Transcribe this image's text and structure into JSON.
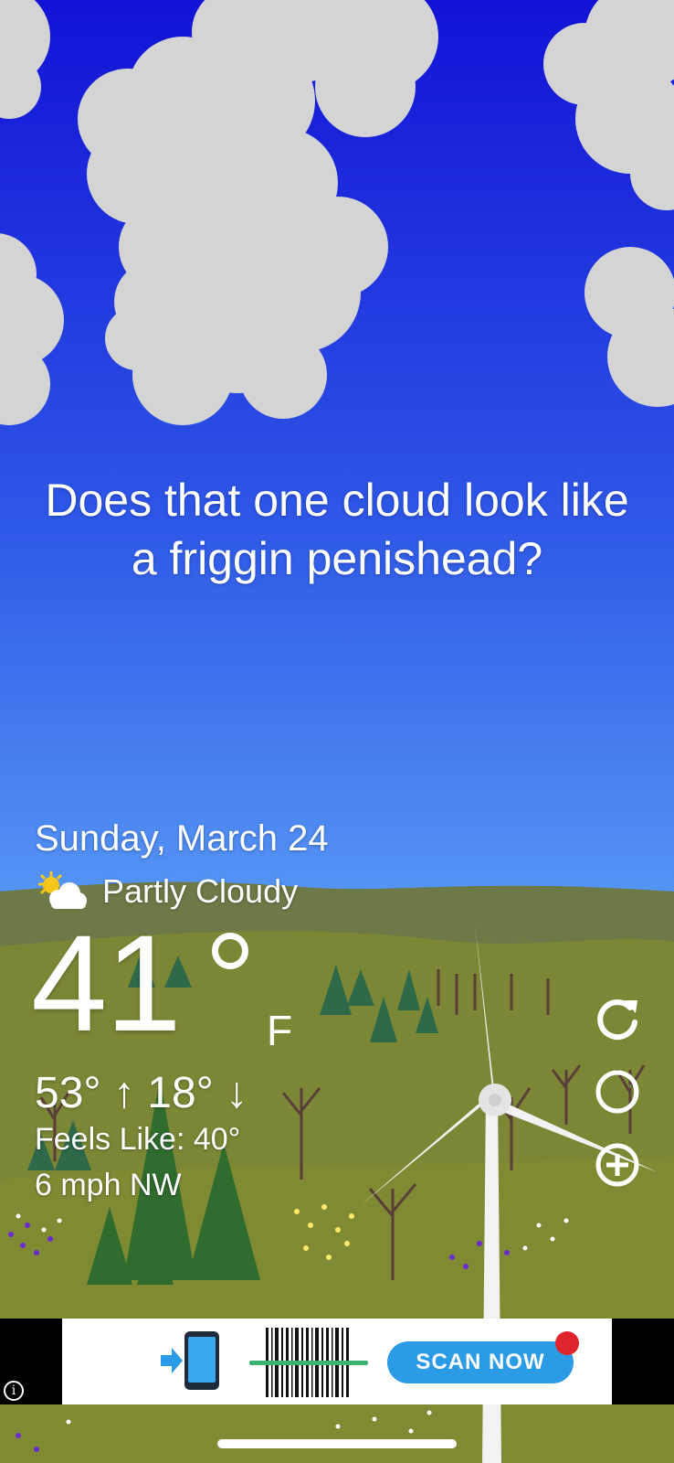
{
  "quote": {
    "line1": "Does that one cloud look like",
    "line2": "a friggin penishead?"
  },
  "weather": {
    "date": "Sunday, March 24",
    "condition": "Partly Cloudy",
    "condition_icon": "partly-cloudy-icon",
    "temperature": "41",
    "unit": "F",
    "high": "53°",
    "low": "18°",
    "feels_like": "Feels Like: 40°",
    "wind": "6 mph NW"
  },
  "side_actions": [
    {
      "name": "refresh",
      "icon": "refresh-icon"
    },
    {
      "name": "moon-phase",
      "icon": "moon-icon"
    },
    {
      "name": "add-location",
      "icon": "plus-circle-icon"
    }
  ],
  "ad": {
    "cta": "SCAN NOW",
    "brand_color": "#2b9be6",
    "badge_color": "#e0242e"
  },
  "colors": {
    "sky_top": "#1414d8",
    "sky_bottom": "#5aa2f6",
    "hill": "#6e7a3a",
    "grass": "#7f8a35"
  }
}
